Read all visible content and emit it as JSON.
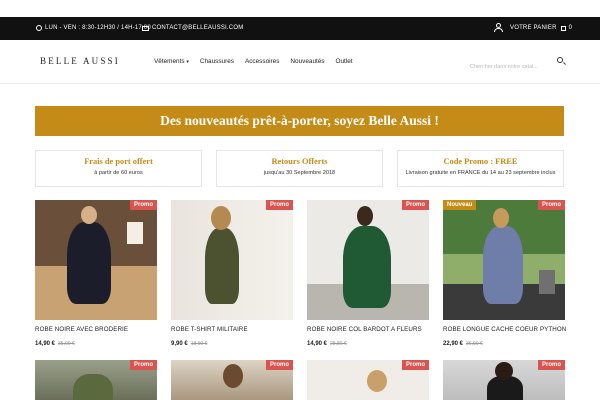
{
  "topbar": {
    "hours": "LUN - VEN : 8:30-12H30 / 14H-17:00",
    "email": "CONTACT@BELLEAUSSI.COM",
    "cart_label": "VOTRE PANIER",
    "cart_count": "0"
  },
  "header": {
    "logo": "BELLE AUSSI",
    "nav": [
      "Vêtements",
      "Chaussures",
      "Accessoires",
      "Nouveautés",
      "Outlet"
    ],
    "search_placeholder": "Chercher dans notre catal..."
  },
  "banner": "Des nouveautés prêt-à-porter, soyez Belle Aussi !",
  "info": [
    {
      "title": "Frais de port offert",
      "subtitle": "à partir de 60 euros"
    },
    {
      "title": "Retours Offerts",
      "subtitle": "jusqu'au 30 Septembre 2018"
    },
    {
      "title": "Code Promo : FREE",
      "subtitle": "Livraison gratuite en FRANCE du 14 au 23 septembre inclus"
    }
  ],
  "products": [
    {
      "badge": "Promo",
      "name": "ROBE NOIRE AVEC BRODERIE",
      "price": "14,90 €",
      "old_price": "35,00 €"
    },
    {
      "badge": "Promo",
      "name": "ROBE T-SHIRT MILITAIRE",
      "price": "9,90 €",
      "old_price": "18,90 €"
    },
    {
      "badge": "Promo",
      "name": "ROBE NOIRE COL BARDOT A FLEURS",
      "price": "14,90 €",
      "old_price": "28,80 €"
    },
    {
      "badge": "Promo",
      "badge_new": "Nouveau",
      "name": "ROBE LONGUE CACHE COEUR PYTHON",
      "price": "22,90 €",
      "old_price": "36,90 €"
    },
    {
      "badge": "Promo"
    },
    {
      "badge": "Promo"
    },
    {
      "badge": "Promo"
    },
    {
      "badge": "Promo"
    }
  ],
  "colors": {
    "accent": "#c48b17",
    "promo": "#d9534f",
    "topbar": "#111111"
  }
}
